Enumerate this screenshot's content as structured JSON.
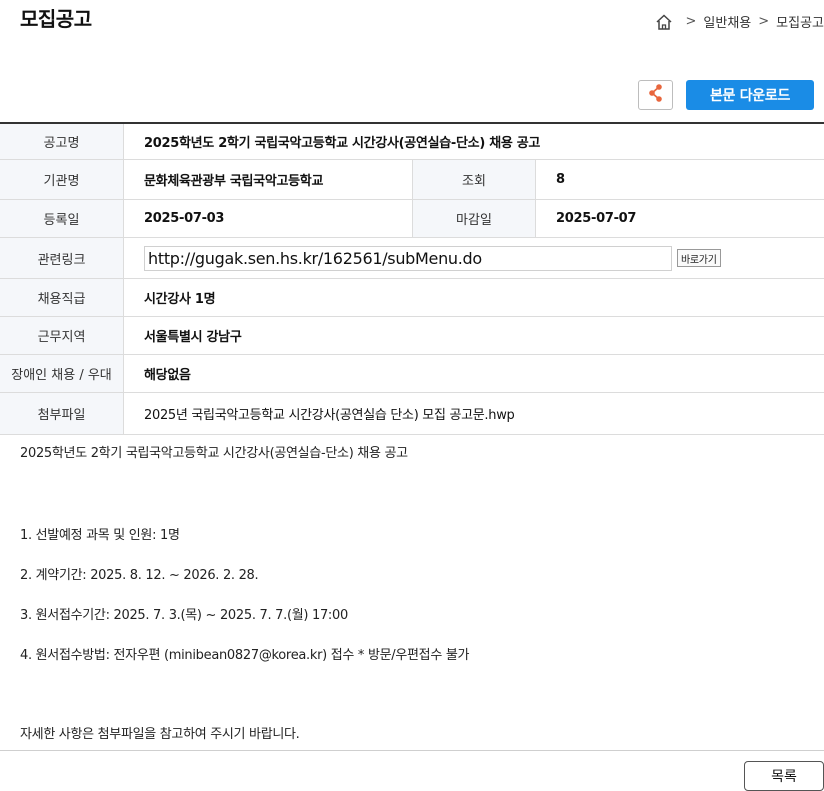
{
  "page": {
    "title": "모집공고"
  },
  "breadcrumb": {
    "items": [
      "일반채용",
      "모집공고"
    ],
    "separator": ">"
  },
  "toolbar": {
    "download_label": "본문 다운로드",
    "share_icon_color": "#e8663d",
    "download_color": "#1a8ce6"
  },
  "info": {
    "title_label": "공고명",
    "title_value": "2025학년도 2학기 국립국악고등학교 시간강사(공연실습-단소) 채용 공고",
    "org_label": "기관명",
    "org_value": "문화체육관광부 국립국악고등학교",
    "views_label": "조회",
    "views_value": "8",
    "reg_label": "등록일",
    "reg_value": "2025-07-03",
    "deadline_label": "마감일",
    "deadline_value": "2025-07-07",
    "link_label": "관련링크",
    "link_value": "http://gugak.sen.hs.kr/162561/subMenu.do",
    "go_label": "바로가기",
    "position_label": "채용직급",
    "position_value": "시간강사 1명",
    "location_label": "근무지역",
    "location_value": "서울특별시 강남구",
    "disability_label": "장애인 채용 / 우대",
    "disability_value": "해당없음",
    "attach_label": "첨부파일",
    "attach_value": "2025년 국립국악고등학교 시간강사(공연실습 단소) 모집 공고문.hwp"
  },
  "body": {
    "lines": [
      "2025학년도 2학기 국립국악고등학교 시간강사(공연실습-단소) 채용 공고",
      "1. 선발예정 과목 및 인원: 1명",
      "2. 계약기간: 2025. 8. 12. ~ 2026. 2. 28.",
      "3. 원서접수기간: 2025. 7. 3.(목) ~ 2025. 7. 7.(월) 17:00",
      "4. 원서접수방법: 전자우편 (minibean0827@korea.kr) 접수 * 방문/우편접수 불가",
      "자세한 사항은 첨부파일을 참고하여 주시기 바랍니다."
    ]
  },
  "footer": {
    "list_label": "목록"
  }
}
